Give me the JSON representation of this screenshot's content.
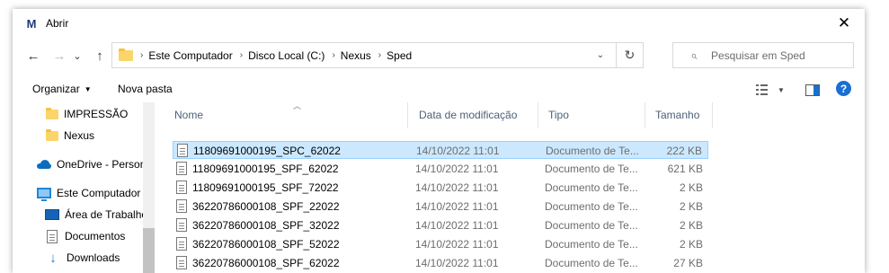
{
  "window": {
    "title": "Abrir",
    "app_icon_letter": "M",
    "close_glyph": "✕"
  },
  "nav": {
    "back_glyph": "←",
    "forward_glyph": "→",
    "recent_glyph": "⌄",
    "up_glyph": "↑"
  },
  "address": {
    "breadcrumbs": [
      "Este Computador",
      "Disco Local (C:)",
      "Nexus",
      "Sped"
    ],
    "separator": "›",
    "dropdown_glyph": "⌄",
    "refresh_glyph": "↻"
  },
  "search": {
    "placeholder": "Pesquisar em Sped",
    "icon": "search-icon"
  },
  "toolbar": {
    "organize_label": "Organizar",
    "new_folder_label": "Nova pasta"
  },
  "sidebar": {
    "items": [
      {
        "label": "IMPRESSÃO",
        "icon": "folder-icon"
      },
      {
        "label": "Nexus",
        "icon": "folder-icon"
      },
      {
        "label": "OneDrive - Person",
        "icon": "onedrive-icon"
      },
      {
        "label": "Este Computador",
        "icon": "computer-icon"
      },
      {
        "label": "Área de Trabalho",
        "icon": "desktop-icon"
      },
      {
        "label": "Documentos",
        "icon": "documents-icon"
      },
      {
        "label": "Downloads",
        "icon": "downloads-icon"
      }
    ]
  },
  "columns": {
    "name": "Nome",
    "modified": "Data de modificação",
    "type": "Tipo",
    "size": "Tamanho"
  },
  "files": [
    {
      "name": "11809691000195_SPC_62022",
      "modified": "14/10/2022 11:01",
      "type": "Documento de Te...",
      "size": "222 KB",
      "selected": true
    },
    {
      "name": "11809691000195_SPF_62022",
      "modified": "14/10/2022 11:01",
      "type": "Documento de Te...",
      "size": "621 KB",
      "selected": false
    },
    {
      "name": "11809691000195_SPF_72022",
      "modified": "14/10/2022 11:01",
      "type": "Documento de Te...",
      "size": "2 KB",
      "selected": false
    },
    {
      "name": "36220786000108_SPF_22022",
      "modified": "14/10/2022 11:01",
      "type": "Documento de Te...",
      "size": "2 KB",
      "selected": false
    },
    {
      "name": "36220786000108_SPF_32022",
      "modified": "14/10/2022 11:01",
      "type": "Documento de Te...",
      "size": "2 KB",
      "selected": false
    },
    {
      "name": "36220786000108_SPF_52022",
      "modified": "14/10/2022 11:01",
      "type": "Documento de Te...",
      "size": "2 KB",
      "selected": false
    },
    {
      "name": "36220786000108_SPF_62022",
      "modified": "14/10/2022 11:01",
      "type": "Documento de Te...",
      "size": "27 KB",
      "selected": false
    }
  ],
  "colors": {
    "selection_bg": "#cce8ff",
    "selection_border": "#99d1ff",
    "help_blue": "#1a6fd1",
    "folder_yellow": "#fbd56b"
  }
}
